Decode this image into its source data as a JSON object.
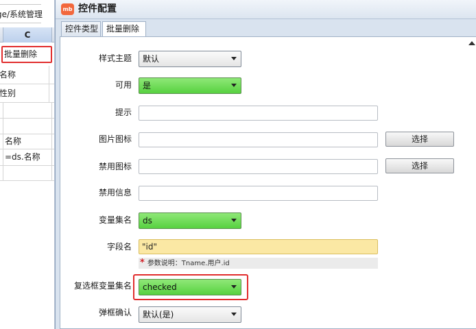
{
  "sheet": {
    "path": "page/系统管理",
    "column_header": "C",
    "rows": [
      {
        "text": "批量删除",
        "highlighted": true
      },
      {
        "text": "名称"
      },
      {
        "text": "性别"
      },
      {
        "text": ""
      },
      {
        "text": ""
      },
      {
        "text": "名称"
      },
      {
        "text": "=ds.名称"
      }
    ]
  },
  "dialog": {
    "logo": "mb",
    "title": "控件配置",
    "tabs": [
      {
        "label": "控件类型",
        "active": false
      },
      {
        "label": "批量删除",
        "active": true
      }
    ]
  },
  "form": {
    "style_theme": {
      "label": "样式主题",
      "value": "默认"
    },
    "enabled": {
      "label": "可用",
      "value": "是"
    },
    "hint": {
      "label": "提示",
      "value": ""
    },
    "image_icon": {
      "label": "图片图标",
      "value": "",
      "button": "选择"
    },
    "disabled_icon": {
      "label": "禁用图标",
      "value": "",
      "button": "选择"
    },
    "disabled_info": {
      "label": "禁用信息",
      "value": ""
    },
    "variable_set": {
      "label": "变量集名",
      "value": "ds"
    },
    "field_name": {
      "label": "字段名",
      "value": "\"id\""
    },
    "param_note": {
      "star": "*",
      "text": "参数说明：Tname.用户.id"
    },
    "checkbox_variable_set": {
      "label": "复选框变量集名",
      "value": "checked"
    },
    "popup_confirm": {
      "label": "弹框确认",
      "value": "默认(是)"
    }
  },
  "colors": {
    "green_select": "#57d140",
    "yellow_input": "#fbe8a4",
    "highlight_red": "#e12c2c",
    "logo_orange": "#f2673c"
  },
  "icons": {
    "logo": "app-logo-icon",
    "dropdown": "chevron-down-icon",
    "required": "asterisk-icon",
    "scroll": "scroll-up-icon"
  }
}
